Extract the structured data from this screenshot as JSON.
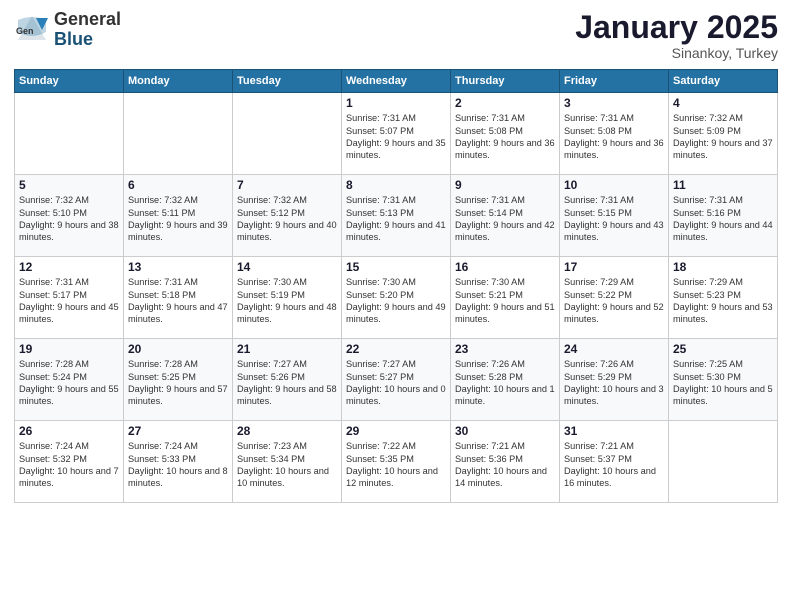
{
  "logo": {
    "general": "General",
    "blue": "Blue"
  },
  "title": "January 2025",
  "subtitle": "Sinankoy, Turkey",
  "days_header": [
    "Sunday",
    "Monday",
    "Tuesday",
    "Wednesday",
    "Thursday",
    "Friday",
    "Saturday"
  ],
  "weeks": [
    [
      {
        "day": "",
        "info": ""
      },
      {
        "day": "",
        "info": ""
      },
      {
        "day": "",
        "info": ""
      },
      {
        "day": "1",
        "info": "Sunrise: 7:31 AM\nSunset: 5:07 PM\nDaylight: 9 hours\nand 35 minutes."
      },
      {
        "day": "2",
        "info": "Sunrise: 7:31 AM\nSunset: 5:08 PM\nDaylight: 9 hours\nand 36 minutes."
      },
      {
        "day": "3",
        "info": "Sunrise: 7:31 AM\nSunset: 5:08 PM\nDaylight: 9 hours\nand 36 minutes."
      },
      {
        "day": "4",
        "info": "Sunrise: 7:32 AM\nSunset: 5:09 PM\nDaylight: 9 hours\nand 37 minutes."
      }
    ],
    [
      {
        "day": "5",
        "info": "Sunrise: 7:32 AM\nSunset: 5:10 PM\nDaylight: 9 hours\nand 38 minutes."
      },
      {
        "day": "6",
        "info": "Sunrise: 7:32 AM\nSunset: 5:11 PM\nDaylight: 9 hours\nand 39 minutes."
      },
      {
        "day": "7",
        "info": "Sunrise: 7:32 AM\nSunset: 5:12 PM\nDaylight: 9 hours\nand 40 minutes."
      },
      {
        "day": "8",
        "info": "Sunrise: 7:31 AM\nSunset: 5:13 PM\nDaylight: 9 hours\nand 41 minutes."
      },
      {
        "day": "9",
        "info": "Sunrise: 7:31 AM\nSunset: 5:14 PM\nDaylight: 9 hours\nand 42 minutes."
      },
      {
        "day": "10",
        "info": "Sunrise: 7:31 AM\nSunset: 5:15 PM\nDaylight: 9 hours\nand 43 minutes."
      },
      {
        "day": "11",
        "info": "Sunrise: 7:31 AM\nSunset: 5:16 PM\nDaylight: 9 hours\nand 44 minutes."
      }
    ],
    [
      {
        "day": "12",
        "info": "Sunrise: 7:31 AM\nSunset: 5:17 PM\nDaylight: 9 hours\nand 45 minutes."
      },
      {
        "day": "13",
        "info": "Sunrise: 7:31 AM\nSunset: 5:18 PM\nDaylight: 9 hours\nand 47 minutes."
      },
      {
        "day": "14",
        "info": "Sunrise: 7:30 AM\nSunset: 5:19 PM\nDaylight: 9 hours\nand 48 minutes."
      },
      {
        "day": "15",
        "info": "Sunrise: 7:30 AM\nSunset: 5:20 PM\nDaylight: 9 hours\nand 49 minutes."
      },
      {
        "day": "16",
        "info": "Sunrise: 7:30 AM\nSunset: 5:21 PM\nDaylight: 9 hours\nand 51 minutes."
      },
      {
        "day": "17",
        "info": "Sunrise: 7:29 AM\nSunset: 5:22 PM\nDaylight: 9 hours\nand 52 minutes."
      },
      {
        "day": "18",
        "info": "Sunrise: 7:29 AM\nSunset: 5:23 PM\nDaylight: 9 hours\nand 53 minutes."
      }
    ],
    [
      {
        "day": "19",
        "info": "Sunrise: 7:28 AM\nSunset: 5:24 PM\nDaylight: 9 hours\nand 55 minutes."
      },
      {
        "day": "20",
        "info": "Sunrise: 7:28 AM\nSunset: 5:25 PM\nDaylight: 9 hours\nand 57 minutes."
      },
      {
        "day": "21",
        "info": "Sunrise: 7:27 AM\nSunset: 5:26 PM\nDaylight: 9 hours\nand 58 minutes."
      },
      {
        "day": "22",
        "info": "Sunrise: 7:27 AM\nSunset: 5:27 PM\nDaylight: 10 hours\nand 0 minutes."
      },
      {
        "day": "23",
        "info": "Sunrise: 7:26 AM\nSunset: 5:28 PM\nDaylight: 10 hours\nand 1 minute."
      },
      {
        "day": "24",
        "info": "Sunrise: 7:26 AM\nSunset: 5:29 PM\nDaylight: 10 hours\nand 3 minutes."
      },
      {
        "day": "25",
        "info": "Sunrise: 7:25 AM\nSunset: 5:30 PM\nDaylight: 10 hours\nand 5 minutes."
      }
    ],
    [
      {
        "day": "26",
        "info": "Sunrise: 7:24 AM\nSunset: 5:32 PM\nDaylight: 10 hours\nand 7 minutes."
      },
      {
        "day": "27",
        "info": "Sunrise: 7:24 AM\nSunset: 5:33 PM\nDaylight: 10 hours\nand 8 minutes."
      },
      {
        "day": "28",
        "info": "Sunrise: 7:23 AM\nSunset: 5:34 PM\nDaylight: 10 hours\nand 10 minutes."
      },
      {
        "day": "29",
        "info": "Sunrise: 7:22 AM\nSunset: 5:35 PM\nDaylight: 10 hours\nand 12 minutes."
      },
      {
        "day": "30",
        "info": "Sunrise: 7:21 AM\nSunset: 5:36 PM\nDaylight: 10 hours\nand 14 minutes."
      },
      {
        "day": "31",
        "info": "Sunrise: 7:21 AM\nSunset: 5:37 PM\nDaylight: 10 hours\nand 16 minutes."
      },
      {
        "day": "",
        "info": ""
      }
    ]
  ]
}
